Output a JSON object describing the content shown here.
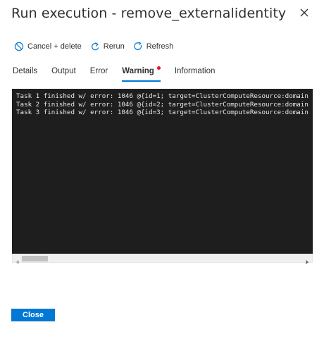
{
  "panel": {
    "title": "Run execution - remove_externalidentity"
  },
  "toolbar": {
    "cancel_label": "Cancel + delete",
    "rerun_label": "Rerun",
    "refresh_label": "Refresh"
  },
  "tabs": [
    {
      "label": "Details",
      "active": false
    },
    {
      "label": "Output",
      "active": false
    },
    {
      "label": "Error",
      "active": false
    },
    {
      "label": "Warning",
      "active": true,
      "has_indicator": true
    },
    {
      "label": "Information",
      "active": false
    }
  ],
  "console": {
    "lines": [
      "Task 1 finished w/ error: 1046 @{id=1; target=ClusterComputeResource:domain",
      "Task 2 finished w/ error: 1046 @{id=2; target=ClusterComputeResource:domain",
      "Task 3 finished w/ error: 1046 @{id=3; target=ClusterComputeResource:domain"
    ]
  },
  "footer": {
    "close_label": "Close"
  },
  "colors": {
    "accent": "#0078d4",
    "indicator": "#e81123",
    "console_bg": "#1e1e1e"
  }
}
